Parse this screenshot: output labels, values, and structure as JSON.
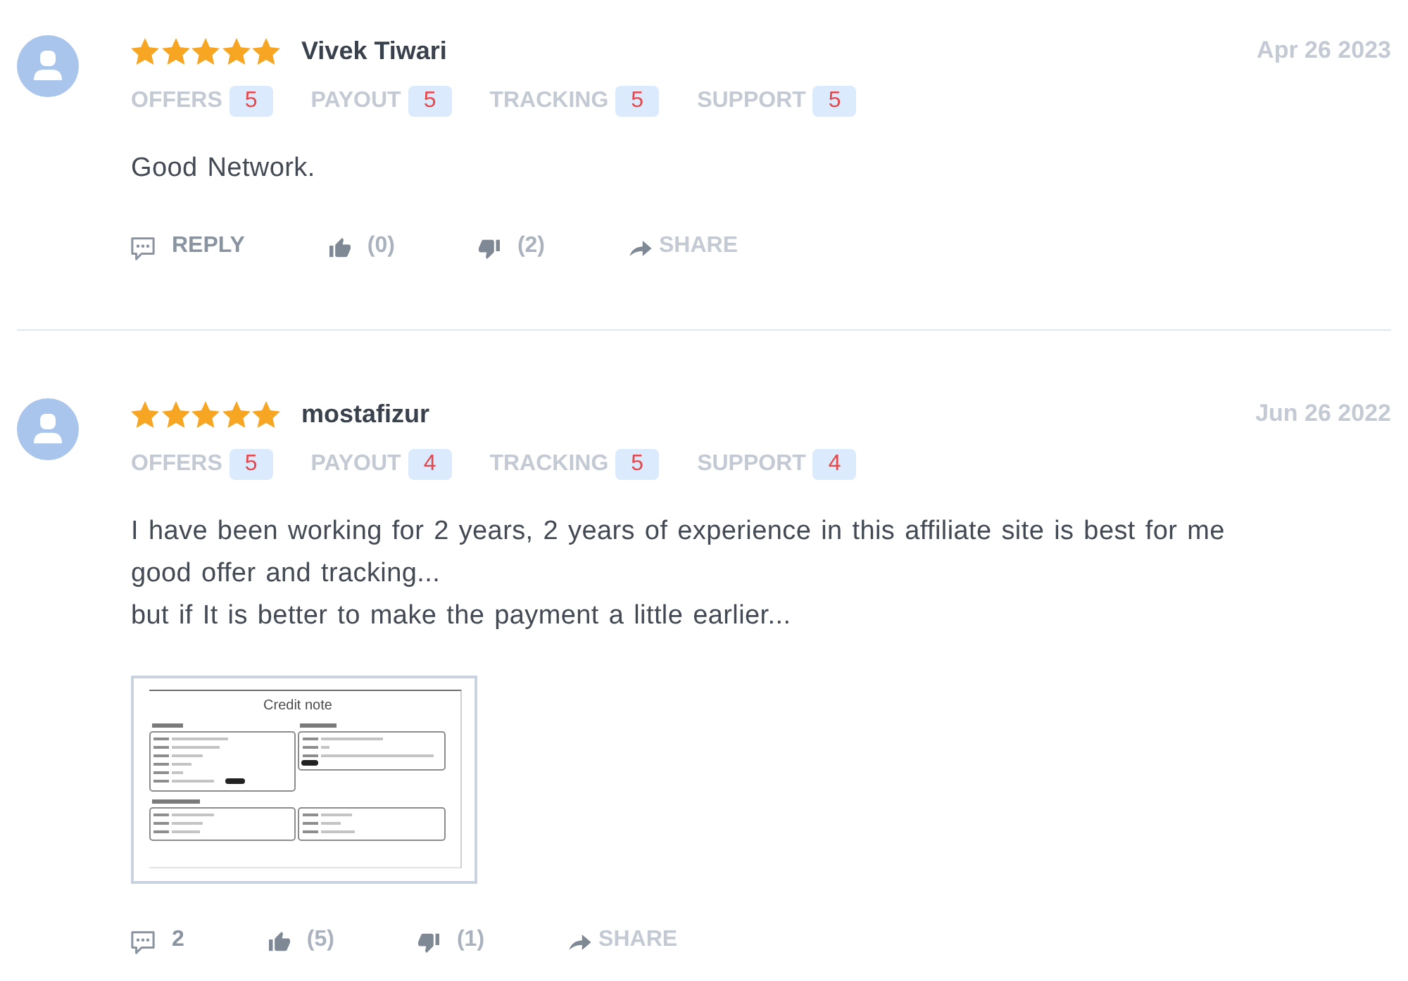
{
  "reviews": [
    {
      "stars": 5,
      "name": "Vivek Tiwari",
      "date": "Apr 26 2023",
      "ratings": [
        {
          "label": "OFFERS",
          "score": "5"
        },
        {
          "label": "PAYOUT",
          "score": "5"
        },
        {
          "label": "TRACKING",
          "score": "5"
        },
        {
          "label": "SUPPORT",
          "score": "5"
        }
      ],
      "text": "Good Network.",
      "actions": {
        "reply": "REPLY",
        "likes": "(0)",
        "dislikes": "(2)",
        "share": "SHARE"
      }
    },
    {
      "stars": 5,
      "name": "mostafizur",
      "date": "Jun 26 2022",
      "ratings": [
        {
          "label": "OFFERS",
          "score": "5"
        },
        {
          "label": "PAYOUT",
          "score": "4"
        },
        {
          "label": "TRACKING",
          "score": "5"
        },
        {
          "label": "SUPPORT",
          "score": "4"
        }
      ],
      "text": "I have been working for 2 years, 2 years of experience in this affiliate site is best for me\ngood offer and tracking...\nbut if It is better to make the payment a little earlier...",
      "attachment": {
        "title": "Credit note"
      },
      "actions": {
        "reply": "2",
        "likes": "(5)",
        "dislikes": "(1)",
        "share": "SHARE"
      }
    }
  ]
}
